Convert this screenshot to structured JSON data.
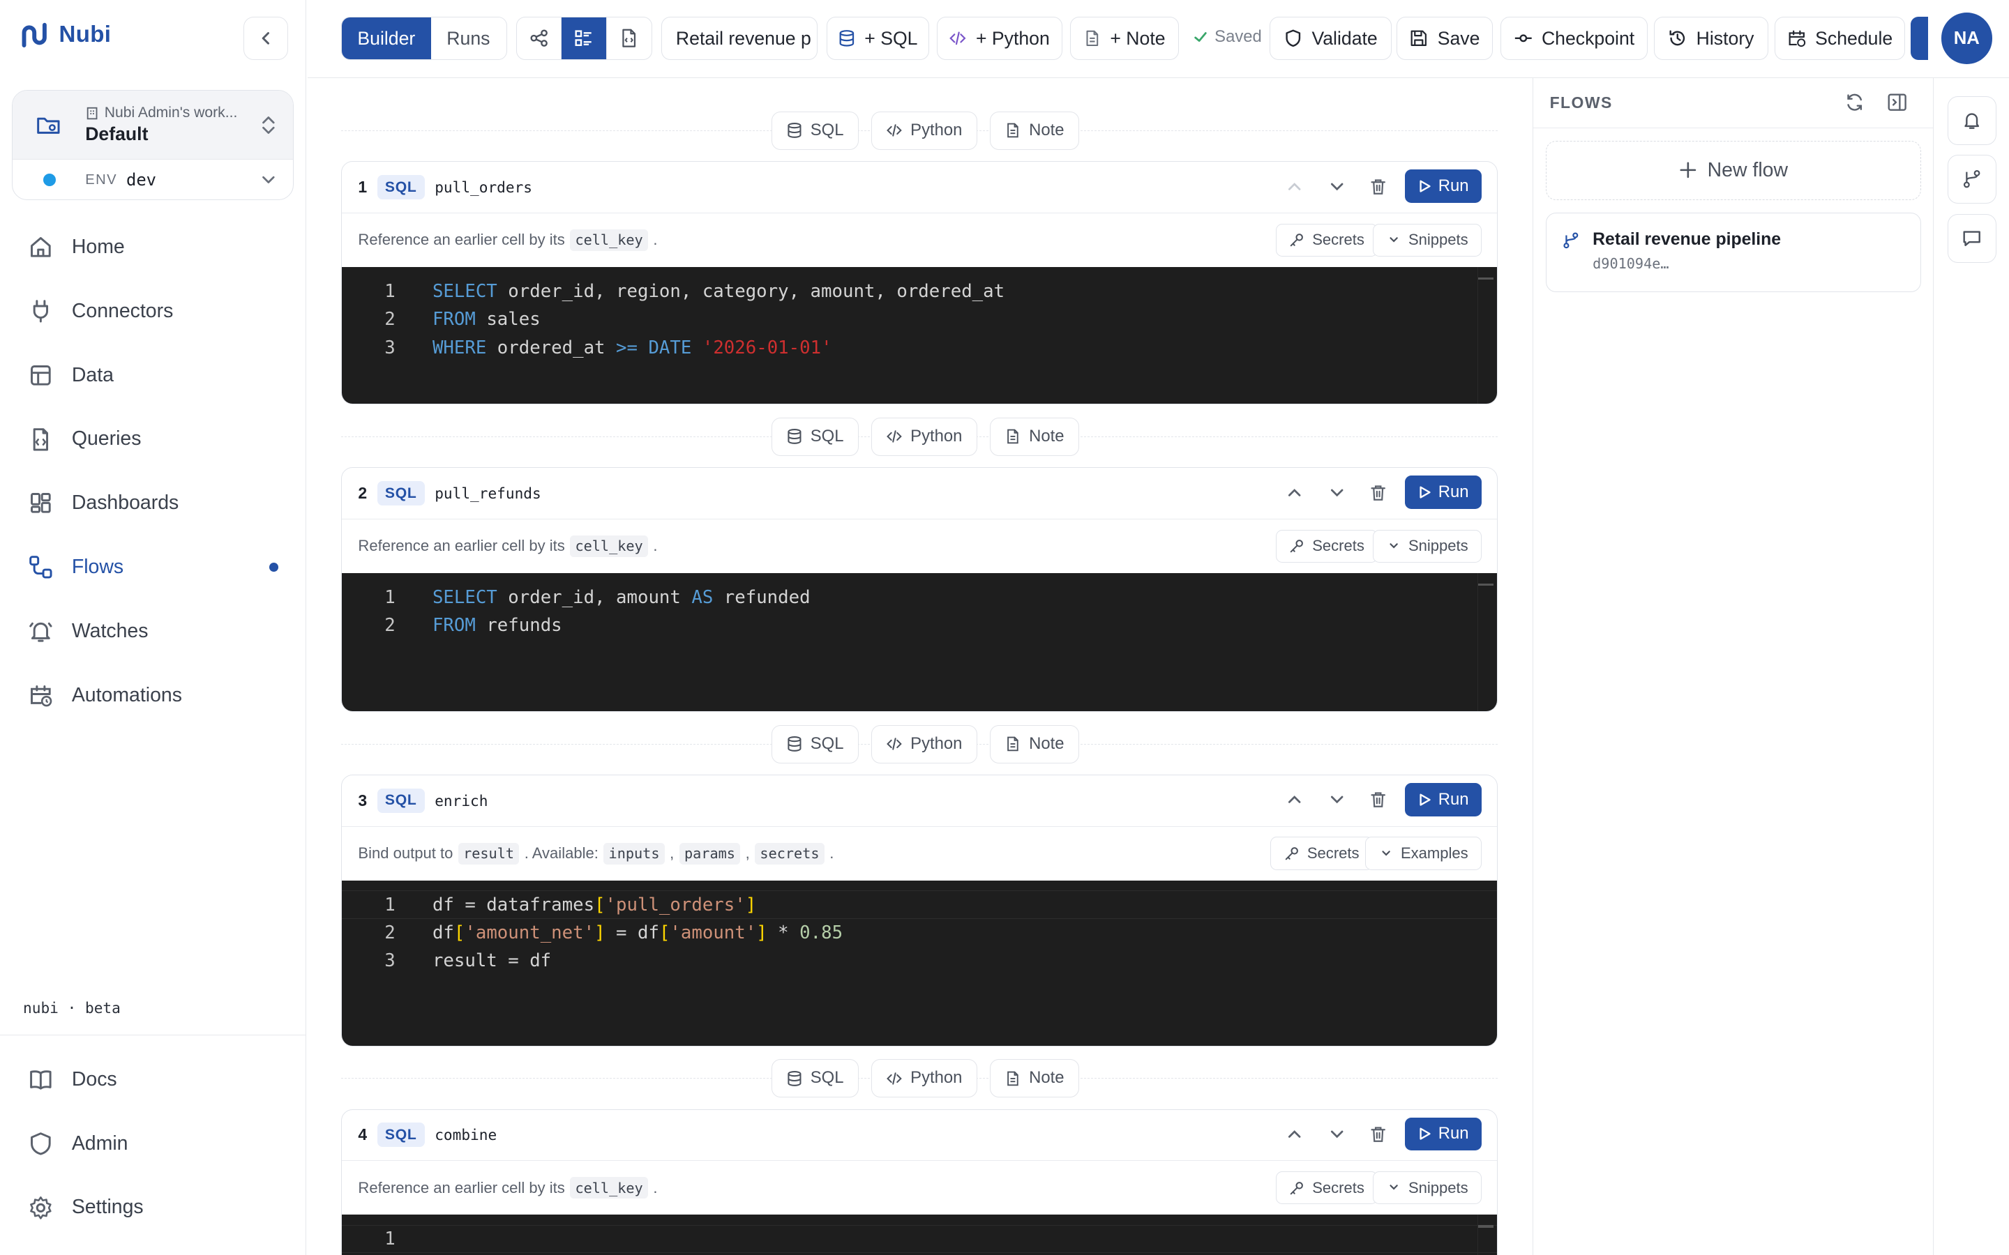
{
  "brand": {
    "name": "Nubi"
  },
  "workspace": {
    "owner": "Nubi Admin's work...",
    "name": "Default",
    "env_label": "ENV",
    "env_value": "dev"
  },
  "sidebar": {
    "items": [
      {
        "label": "Home",
        "icon": "home-icon"
      },
      {
        "label": "Connectors",
        "icon": "plug-icon"
      },
      {
        "label": "Data",
        "icon": "table-icon"
      },
      {
        "label": "Queries",
        "icon": "file-code-icon"
      },
      {
        "label": "Dashboards",
        "icon": "dashboard-icon"
      },
      {
        "label": "Flows",
        "icon": "flow-icon",
        "active": true
      },
      {
        "label": "Watches",
        "icon": "bell-icon"
      },
      {
        "label": "Automations",
        "icon": "calendar-clock-icon"
      }
    ],
    "version": "nubi · beta",
    "bottom": [
      {
        "label": "Docs",
        "icon": "book-icon"
      },
      {
        "label": "Admin",
        "icon": "shield-icon"
      },
      {
        "label": "Settings",
        "icon": "gear-icon"
      }
    ]
  },
  "toolbar": {
    "builder": "Builder",
    "runs": "Runs",
    "flow_name": "Retail revenue p",
    "add_sql": "+ SQL",
    "add_python": "+ Python",
    "add_note": "+ Note",
    "saved": "Saved",
    "validate": "Validate",
    "save": "Save",
    "checkpoint": "Checkpoint",
    "history": "History",
    "schedule": "Schedule",
    "avatar": "NA"
  },
  "insert": {
    "sql": "SQL",
    "python": "Python",
    "note": "Note"
  },
  "cells": [
    {
      "num": "1",
      "type": "SQL",
      "key": "pull_orders",
      "hint_pre": "Reference an earlier cell by its",
      "hint_chips": [
        "cell_key"
      ],
      "hint_post": ".",
      "btn1": "Secrets",
      "btn2": "Snippets",
      "run": "Run",
      "lines": [
        "SELECT order_id, region, category, amount, ordered_at",
        "FROM sales",
        "WHERE ordered_at >= DATE '2026-01-01'"
      ]
    },
    {
      "num": "2",
      "type": "SQL",
      "key": "pull_refunds",
      "hint_pre": "Reference an earlier cell by its",
      "hint_chips": [
        "cell_key"
      ],
      "hint_post": ".",
      "btn1": "Secrets",
      "btn2": "Snippets",
      "run": "Run",
      "lines": [
        "SELECT order_id, amount AS refunded",
        "FROM refunds"
      ]
    },
    {
      "num": "3",
      "type": "SQL",
      "key": "enrich",
      "hint_pre": "Bind output to",
      "hint_chips": [
        "result",
        "inputs",
        "params",
        "secrets"
      ],
      "hint_mid": ". Available:",
      "hint_post": ".",
      "btn1": "Secrets",
      "btn2": "Examples",
      "run": "Run",
      "lines": [
        "df = dataframes['pull_orders']",
        "df['amount_net'] = df['amount'] * 0.85",
        "result = df"
      ]
    },
    {
      "num": "4",
      "type": "SQL",
      "key": "combine",
      "hint_pre": "Reference an earlier cell by its",
      "hint_chips": [
        "cell_key"
      ],
      "hint_post": ".",
      "btn1": "Secrets",
      "btn2": "Snippets",
      "run": "Run",
      "lines": [
        ""
      ]
    }
  ],
  "flows_panel": {
    "title": "FLOWS",
    "new_flow": "New flow",
    "items": [
      {
        "name": "Retail revenue pipeline",
        "id": "d901094e…"
      }
    ]
  }
}
